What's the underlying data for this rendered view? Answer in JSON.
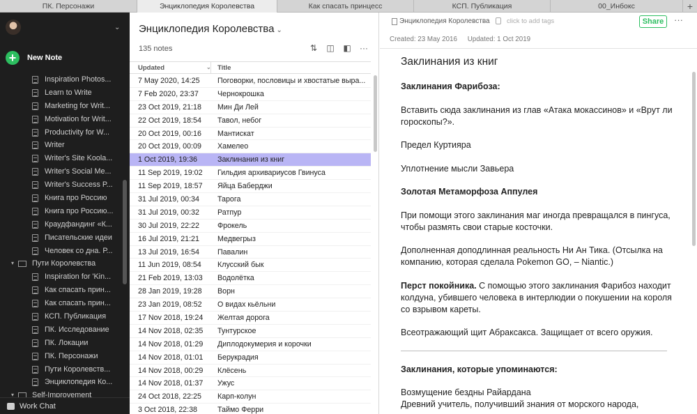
{
  "tabs": [
    {
      "label": "ПК. Персонажи",
      "active": false
    },
    {
      "label": "Энциклопедия Королевства",
      "active": true
    },
    {
      "label": "Как спасать принцесс",
      "active": false
    },
    {
      "label": "КСП. Публикация",
      "active": false
    },
    {
      "label": "00_Инбокс",
      "active": false
    }
  ],
  "tab_plus": "+",
  "sidebar": {
    "new_note_label": "New Note",
    "items": [
      {
        "label": "Inspiration Photos...",
        "level": 2,
        "type": "note"
      },
      {
        "label": "Learn to Write",
        "level": 2,
        "type": "note"
      },
      {
        "label": "Marketing for Writ...",
        "level": 2,
        "type": "note"
      },
      {
        "label": "Motivation for Writ...",
        "level": 2,
        "type": "note"
      },
      {
        "label": "Productivity for W...",
        "level": 2,
        "type": "note"
      },
      {
        "label": "Writer",
        "level": 2,
        "type": "note"
      },
      {
        "label": "Writer's Site Koola...",
        "level": 2,
        "type": "note"
      },
      {
        "label": "Writer's Social Me...",
        "level": 2,
        "type": "note"
      },
      {
        "label": "Writer's Success P...",
        "level": 2,
        "type": "note"
      },
      {
        "label": "Книга про Россию",
        "level": 2,
        "type": "note"
      },
      {
        "label": "Книга про Россию...",
        "level": 2,
        "type": "note"
      },
      {
        "label": "Краудфандинг «К...",
        "level": 2,
        "type": "note"
      },
      {
        "label": "Писательские идеи",
        "level": 2,
        "type": "note"
      },
      {
        "label": "Человек со дна. Р...",
        "level": 2,
        "type": "note"
      },
      {
        "label": "Пути Королевства",
        "level": 1,
        "type": "stack"
      },
      {
        "label": "Inspiration for 'Kin...",
        "level": 2,
        "type": "note"
      },
      {
        "label": "Как спасать прин...",
        "level": 2,
        "type": "note"
      },
      {
        "label": "Как спасать прин...",
        "level": 2,
        "type": "note"
      },
      {
        "label": "КСП. Публикация",
        "level": 2,
        "type": "note"
      },
      {
        "label": "ПК. Исследование",
        "level": 2,
        "type": "note"
      },
      {
        "label": "ПК. Локации",
        "level": 2,
        "type": "note"
      },
      {
        "label": "ПК. Персонажи",
        "level": 2,
        "type": "note"
      },
      {
        "label": "Пути Королевств...",
        "level": 2,
        "type": "note"
      },
      {
        "label": "Энциклопедия Ко...",
        "level": 2,
        "type": "note"
      },
      {
        "label": "Self-Improvement",
        "level": 1,
        "type": "stack"
      }
    ],
    "work_chat_label": "Work Chat"
  },
  "notelist": {
    "title": "Энциклопедия Королевства",
    "count": "135 notes",
    "col_updated": "Updated",
    "col_title": "Title",
    "selected_index": 7,
    "rows": [
      {
        "date": "7 May 2020, 14:25",
        "title": "Поговорки, пословицы и хвостатые выра..."
      },
      {
        "date": "7 Feb 2020, 23:37",
        "title": "Чернокрошка"
      },
      {
        "date": "23 Oct 2019, 21:18",
        "title": "Мин Ди Лей"
      },
      {
        "date": "22 Oct 2019, 18:54",
        "title": "Тавол, небог"
      },
      {
        "date": "20 Oct 2019, 00:16",
        "title": "Мантискат"
      },
      {
        "date": "20 Oct 2019, 00:09",
        "title": "Хамелео"
      },
      {
        "date": "1 Oct 2019, 19:36",
        "title": "Заклинания из книг"
      },
      {
        "date": "11 Sep 2019, 19:02",
        "title": "Гильдия архивариусов Гвинуса"
      },
      {
        "date": "11 Sep 2019, 18:57",
        "title": "Яйца Баберджи"
      },
      {
        "date": "31 Jul 2019, 00:34",
        "title": "Тарога"
      },
      {
        "date": "31 Jul 2019, 00:32",
        "title": "Ратпур"
      },
      {
        "date": "30 Jul 2019, 22:22",
        "title": "Фрокель"
      },
      {
        "date": "16 Jul 2019, 21:21",
        "title": "Медвегрыз"
      },
      {
        "date": "13 Jul 2019, 16:54",
        "title": "Павалин"
      },
      {
        "date": "11 Jun 2019, 08:54",
        "title": "Клусский бык"
      },
      {
        "date": "21 Feb 2019, 13:03",
        "title": "Водолётка"
      },
      {
        "date": "28 Jan 2019, 19:28",
        "title": "Ворн"
      },
      {
        "date": "23 Jan 2019, 08:52",
        "title": "О видах кьёльни"
      },
      {
        "date": "17 Nov 2018, 19:24",
        "title": "Желтая дорога"
      },
      {
        "date": "14 Nov 2018, 02:35",
        "title": "Тунтурское"
      },
      {
        "date": "14 Nov 2018, 01:29",
        "title": "Диплодокумерия и корочки"
      },
      {
        "date": "14 Nov 2018, 01:01",
        "title": "Берукрадия"
      },
      {
        "date": "14 Nov 2018, 00:29",
        "title": "Клёсень"
      },
      {
        "date": "14 Nov 2018, 01:37",
        "title": "Ужус"
      },
      {
        "date": "24 Oct 2018, 22:25",
        "title": "Карп-колун"
      },
      {
        "date": "3 Oct 2018, 22:38",
        "title": "Таймо Ферри"
      }
    ]
  },
  "editor": {
    "notebook": "Энциклопедия Королевства",
    "tag_hint": "click to add tags",
    "share_label": "Share",
    "more_label": "···",
    "created": "Created: 23 May 2016",
    "updated": "Updated: 1 Oct 2019",
    "title": "Заклинания из книг",
    "p1_bold": "Заклинания Фарибоза:",
    "p2": "Вставить сюда заклинания из глав «Атака мокассинов» и «Врут ли гороскопы?».",
    "p3": "Предел Куртиярa",
    "p4": "Уплотнение мысли Завьера",
    "p5_bold": "Золотая Метаморфоза Аппулея",
    "p6": "При помощи этого заклинания маг иногда превращался в пингуса, чтобы размять свои старые косточки.",
    "p7": "Дополненная доподлинная реальность Ни Ан Тика. (Отсылка на компанию, которая сделала Pokemon GO, – Niantic.)",
    "p8_bold": "Перст покойника.",
    "p8_rest": " С помощью этого заклинания Фарибоз находит колдуна, убившего человека в интерлюдии о покушении на короля со взрывом кареты.",
    "p9": "Всеотражающий щит Абраксакса. Защищает от всего оружия.",
    "p10_bold": "Заклинания, которые упоминаются:",
    "p11": "Возмущение бездны Райардана",
    "p12": "Древний учитель, получивший знания от морского народа,"
  },
  "colors": {
    "accent_green": "#2dbe60",
    "selection": "#b9b5f5",
    "sidebar_bg": "#1e1e1e"
  }
}
